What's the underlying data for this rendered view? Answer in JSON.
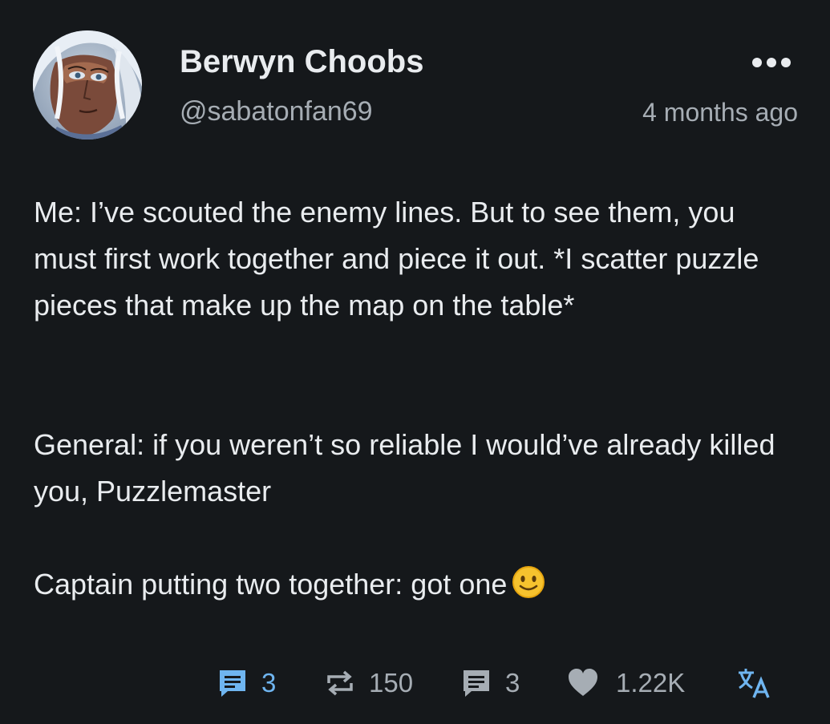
{
  "author": {
    "name": "Berwyn Choobs",
    "handle": "@sabatonfan69"
  },
  "timestamp": "4 months ago",
  "post": {
    "paragraph1": "Me: I’ve scouted the enemy lines. But to see them, you must first work together and piece it out. *I scatter puzzle pieces that make up the map on the table*",
    "paragraph2": "General: if you weren’t so reliable I would’ve already killed you, Puzzlemaster",
    "paragraph3": "Captain putting two together: got one"
  },
  "actions": {
    "replies_self": "3",
    "reblogs": "150",
    "comments": "3",
    "likes": "1.22K"
  },
  "icons": {
    "more": "more-dots-icon",
    "reply": "comment-icon",
    "reblog": "repost-icon",
    "like": "heart-icon",
    "translate": "translate-icon",
    "emoji": "slightly-smiling-face-emoji"
  },
  "colors": {
    "background": "#15181b",
    "text": "#e9ecef",
    "muted": "#a6adb4",
    "accent": "#6fb5f0"
  }
}
